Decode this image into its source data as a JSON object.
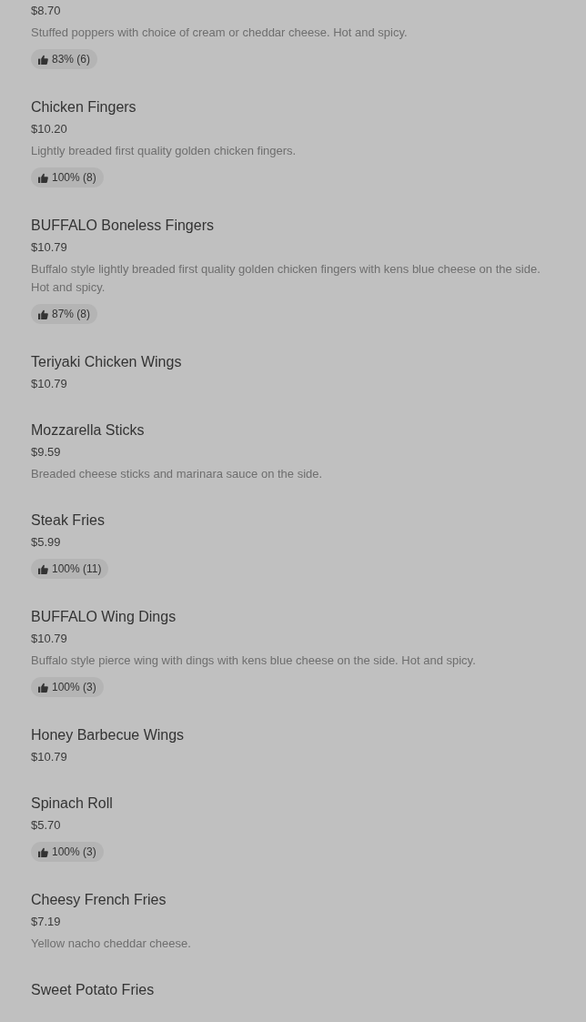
{
  "items": [
    {
      "price": "$8.70",
      "description": "Stuffed poppers with choice of cream or cheddar cheese. Hot and spicy.",
      "rating": "83% (6)"
    },
    {
      "name": "Chicken Fingers",
      "price": "$10.20",
      "description": "Lightly breaded first quality golden chicken fingers.",
      "rating": "100% (8)"
    },
    {
      "name": "BUFFALO Boneless Fingers",
      "price": "$10.79",
      "description": "Buffalo style lightly breaded first quality golden chicken fingers with kens blue cheese on the side. Hot and spicy.",
      "rating": "87% (8)"
    },
    {
      "name": "Teriyaki Chicken Wings",
      "price": "$10.79"
    },
    {
      "name": "Mozzarella Sticks",
      "price": "$9.59",
      "description": "Breaded cheese sticks and marinara sauce on the side."
    },
    {
      "name": "Steak Fries",
      "price": "$5.99",
      "rating": "100% (11)"
    },
    {
      "name": "BUFFALO Wing Dings",
      "price": "$10.79",
      "description": "Buffalo style pierce wing with dings with kens blue cheese on the side. Hot and spicy.",
      "rating": "100% (3)"
    },
    {
      "name": "Honey Barbecue Wings",
      "price": "$10.79"
    },
    {
      "name": "Spinach Roll",
      "price": "$5.70",
      "rating": "100% (3)"
    },
    {
      "name": "Cheesy French Fries",
      "price": "$7.19",
      "description": "Yellow nacho cheddar cheese."
    },
    {
      "name": "Sweet Potato Fries"
    }
  ]
}
